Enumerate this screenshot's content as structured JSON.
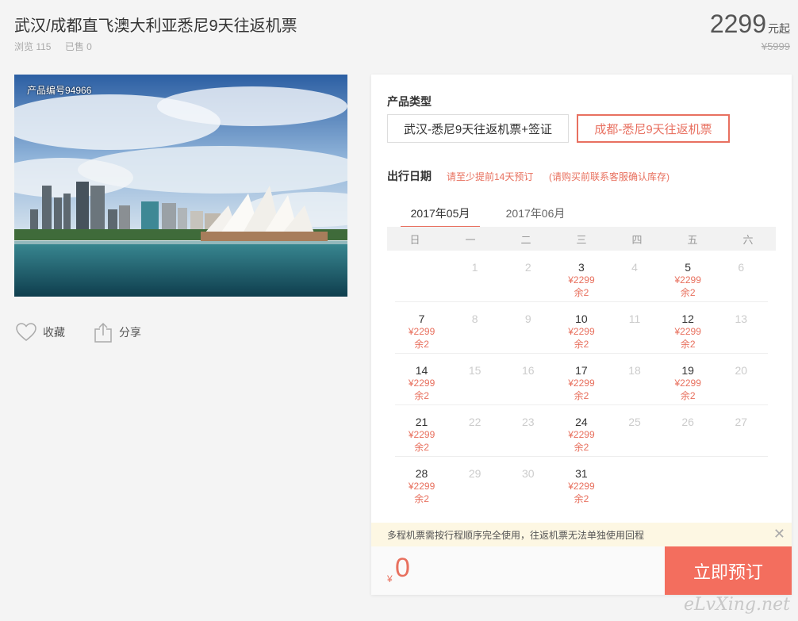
{
  "product": {
    "title": "武汉/成都直飞澳大利亚悉尼9天往返机票",
    "views": "浏览 115",
    "sold": "已售 0",
    "price": "2299",
    "price_unit": "元起",
    "old_price": "¥5999",
    "photo_id": "产品编号94966"
  },
  "actions": {
    "fav": "收藏",
    "share": "分享"
  },
  "booking": {
    "type_label": "产品类型",
    "types": [
      "武汉-悉尼9天往返机票+签证",
      "成都-悉尼9天往返机票"
    ],
    "date_label": "出行日期",
    "note1": "请至少提前14天预订",
    "note2": "(请购买前联系客服确认库存)",
    "months": [
      "2017年05月",
      "2017年06月"
    ],
    "weekdays": [
      "日",
      "一",
      "二",
      "三",
      "四",
      "五",
      "六"
    ],
    "tip": "多程机票需按行程顺序完全使用，往返机票无法单独使用回程",
    "currency": "¥",
    "total": "0",
    "book_label": "立即预订"
  },
  "calendar": [
    [
      {
        "d": ""
      },
      {
        "d": "1",
        "off": true
      },
      {
        "d": "2",
        "off": true
      },
      {
        "d": "3",
        "p": "¥2299",
        "s": "余2"
      },
      {
        "d": "4",
        "off": true
      },
      {
        "d": "5",
        "p": "¥2299",
        "s": "余2"
      },
      {
        "d": "6",
        "off": true
      }
    ],
    [
      {
        "d": "7",
        "p": "¥2299",
        "s": "余2"
      },
      {
        "d": "8",
        "off": true
      },
      {
        "d": "9",
        "off": true
      },
      {
        "d": "10",
        "p": "¥2299",
        "s": "余2"
      },
      {
        "d": "11",
        "off": true
      },
      {
        "d": "12",
        "p": "¥2299",
        "s": "余2"
      },
      {
        "d": "13",
        "off": true
      }
    ],
    [
      {
        "d": "14",
        "p": "¥2299",
        "s": "余2"
      },
      {
        "d": "15",
        "off": true
      },
      {
        "d": "16",
        "off": true
      },
      {
        "d": "17",
        "p": "¥2299",
        "s": "余2"
      },
      {
        "d": "18",
        "off": true
      },
      {
        "d": "19",
        "p": "¥2299",
        "s": "余2"
      },
      {
        "d": "20",
        "off": true
      }
    ],
    [
      {
        "d": "21",
        "p": "¥2299",
        "s": "余2"
      },
      {
        "d": "22",
        "off": true
      },
      {
        "d": "23",
        "off": true
      },
      {
        "d": "24",
        "p": "¥2299",
        "s": "余2"
      },
      {
        "d": "25",
        "off": true
      },
      {
        "d": "26",
        "off": true
      },
      {
        "d": "27",
        "off": true
      }
    ],
    [
      {
        "d": "28",
        "p": "¥2299",
        "s": "余2"
      },
      {
        "d": "29",
        "off": true
      },
      {
        "d": "30",
        "off": true
      },
      {
        "d": "31",
        "p": "¥2299",
        "s": "余2"
      },
      {
        "d": ""
      },
      {
        "d": ""
      },
      {
        "d": ""
      }
    ]
  ],
  "watermark": "eLvXing.net"
}
